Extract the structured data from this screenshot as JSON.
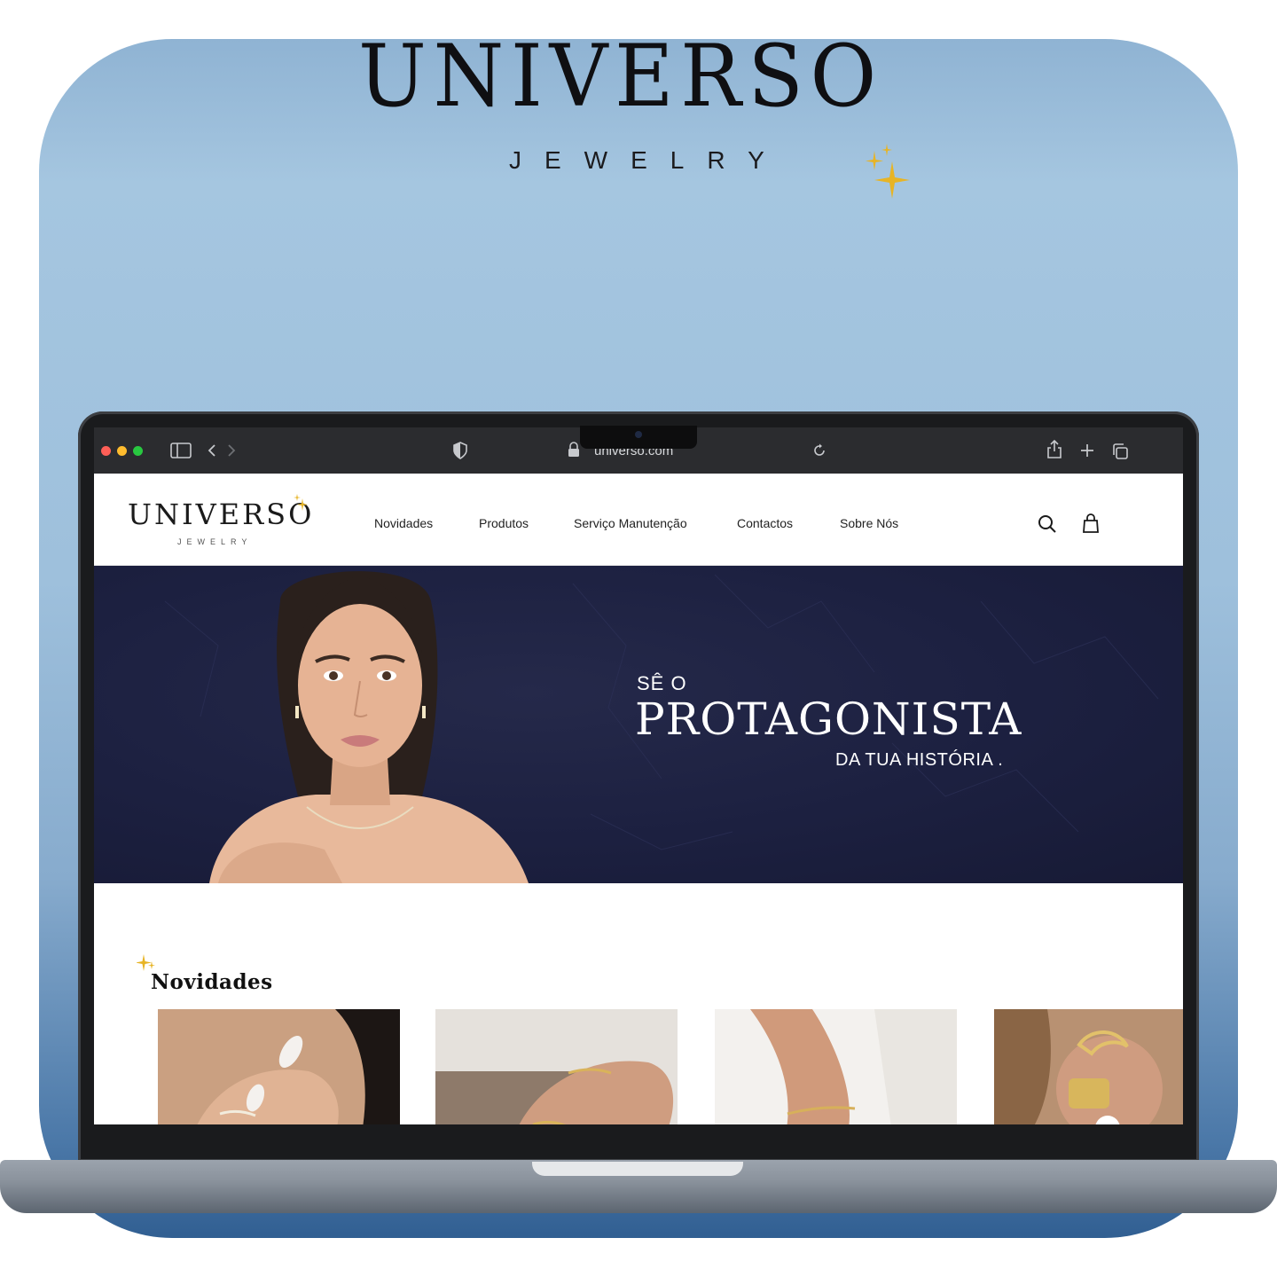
{
  "brand": {
    "title": "UNIVERSO",
    "subtitle": "JEWELRY",
    "accent_color": "#e7b425"
  },
  "browser": {
    "url": "universo.com",
    "traffic_lights": [
      "#fe5f57",
      "#febc2e",
      "#28c840"
    ],
    "icons": [
      "sidebar-icon",
      "back-icon",
      "forward-icon",
      "shield-icon",
      "lock-icon",
      "reload-icon",
      "share-icon",
      "new-tab-icon",
      "tabs-icon"
    ]
  },
  "site": {
    "logo_title": "UNIVERSO",
    "logo_subtitle": "JEWELRY",
    "nav": [
      {
        "label": "Novidades"
      },
      {
        "label": "Produtos"
      },
      {
        "label": "Serviço Manutenção"
      },
      {
        "label": "Contactos"
      },
      {
        "label": "Sobre Nós"
      }
    ],
    "icons": [
      "search-icon",
      "bag-icon"
    ],
    "hero": {
      "pre": "SÊ O",
      "main": "PROTAGONISTA",
      "post": "DA TUA HISTÓRIA ."
    },
    "section_title": "Novidades",
    "products": [
      {
        "name": "product-1"
      },
      {
        "name": "product-2"
      },
      {
        "name": "product-3"
      },
      {
        "name": "product-4"
      }
    ]
  }
}
